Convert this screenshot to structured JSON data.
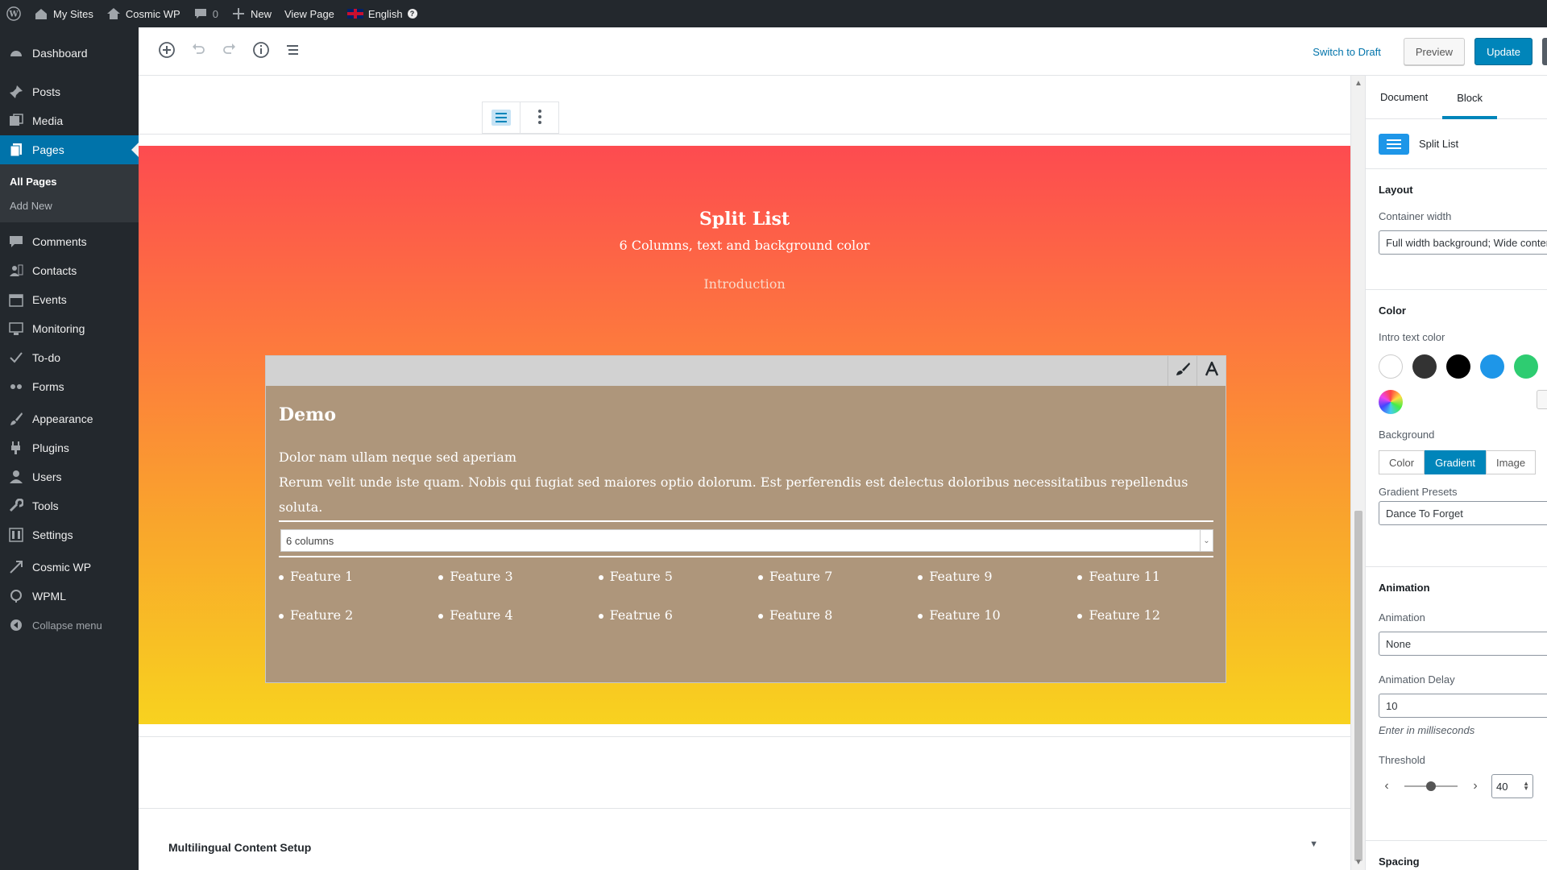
{
  "admin_bar": {
    "my_sites": "My Sites",
    "site_name": "Cosmic WP",
    "comments_count": "0",
    "new_label": "New",
    "view_page": "View Page",
    "language": "English"
  },
  "sidebar": {
    "items": [
      {
        "label": "Dashboard",
        "icon": "dashboard-icon"
      },
      {
        "label": "Posts",
        "icon": "pin-icon"
      },
      {
        "label": "Media",
        "icon": "media-icon"
      },
      {
        "label": "Pages",
        "icon": "pages-icon",
        "active": true
      },
      {
        "label": "Comments",
        "icon": "comment-icon"
      },
      {
        "label": "Contacts",
        "icon": "contacts-icon"
      },
      {
        "label": "Events",
        "icon": "events-icon"
      },
      {
        "label": "Monitoring",
        "icon": "monitoring-icon"
      },
      {
        "label": "To-do",
        "icon": "todo-icon"
      },
      {
        "label": "Forms",
        "icon": "forms-icon"
      },
      {
        "label": "Appearance",
        "icon": "brush-icon"
      },
      {
        "label": "Plugins",
        "icon": "plugin-icon"
      },
      {
        "label": "Users",
        "icon": "user-icon"
      },
      {
        "label": "Tools",
        "icon": "wrench-icon"
      },
      {
        "label": "Settings",
        "icon": "settings-icon"
      },
      {
        "label": "Cosmic WP",
        "icon": "cosmic-icon"
      },
      {
        "label": "WPML",
        "icon": "wpml-icon"
      },
      {
        "label": "Collapse menu",
        "icon": "collapse-icon"
      }
    ],
    "submenu": [
      "All Pages",
      "Add New"
    ]
  },
  "header": {
    "switch_to_draft": "Switch to Draft",
    "preview": "Preview",
    "update": "Update"
  },
  "canvas": {
    "hero_title": "Split List",
    "hero_subtitle": "6 Columns, text and background color",
    "hero_intro": "Introduction",
    "demo": {
      "title": "Demo",
      "line1": "Dolor nam ullam neque sed aperiam",
      "line2": "Rerum velit unde iste quam. Nobis qui fugiat sed maiores optio dolorum. Est perferendis est delectus doloribus necessitatibus repellendus soluta.",
      "columns_select": "6 columns",
      "features": [
        "Feature 1",
        "Feature 2",
        "Feature 3",
        "Feature 4",
        "Feature 5",
        "Featrue 6",
        "Feature 7",
        "Feature 8",
        "Feature 9",
        "Feature 10",
        "Feature 11",
        "Feature 12"
      ]
    },
    "meta_box_title": "Multilingual Content Setup"
  },
  "inspector": {
    "tabs": [
      "Document",
      "Block"
    ],
    "block_name": "Split List",
    "layout": {
      "title": "Layout",
      "container_width_label": "Container width",
      "container_width_value": "Full width background; Wide content"
    },
    "color": {
      "title": "Color",
      "intro_text_color_label": "Intro text color",
      "swatches": [
        "#ffffff",
        "#333333",
        "#000000",
        "#1e96e8",
        "#2ecc71"
      ],
      "background_label": "Background",
      "background_options": [
        "Color",
        "Gradient",
        "Image"
      ],
      "background_selected": "Gradient",
      "gradient_presets_label": "Gradient Presets",
      "gradient_preset_value": "Dance To Forget"
    },
    "animation": {
      "title": "Animation",
      "animation_label": "Animation",
      "animation_value": "None",
      "delay_label": "Animation Delay",
      "delay_value": "10",
      "delay_help": "Enter in milliseconds",
      "threshold_label": "Threshold",
      "threshold_value": "40"
    },
    "spacing_title": "Spacing"
  },
  "colors": {
    "admin_dark": "#23282d",
    "accent": "#0085ba",
    "gradient_top": "#fd4b50",
    "gradient_bottom": "#f8d21f",
    "demo_background": "#ae967b"
  }
}
